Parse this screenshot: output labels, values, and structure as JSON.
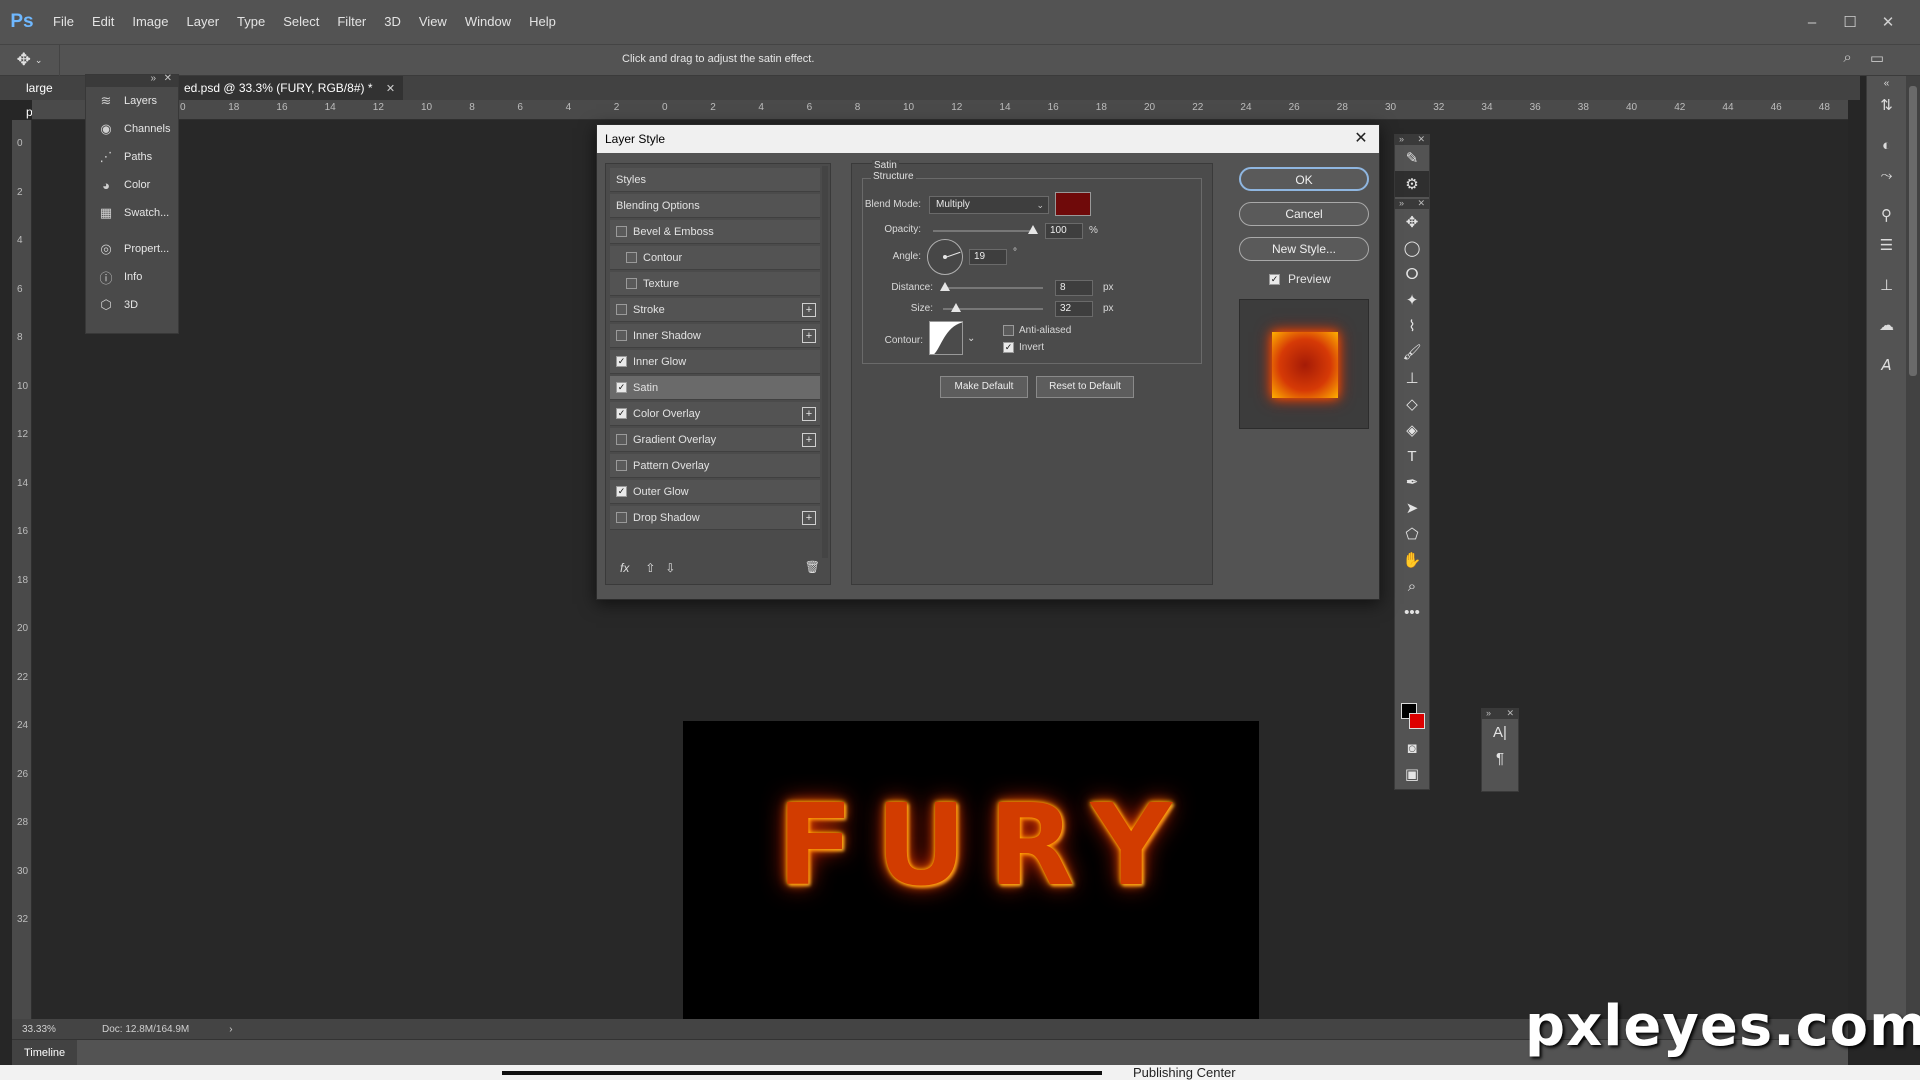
{
  "app": {
    "logo": "Ps"
  },
  "menu": [
    "File",
    "Edit",
    "Image",
    "Layer",
    "Type",
    "Select",
    "Filter",
    "3D",
    "View",
    "Window",
    "Help"
  ],
  "window_controls": {
    "minimize": "–",
    "maximize": "☐",
    "close": "✕"
  },
  "options_bar": {
    "hint": "Click and drag to adjust the satin effect."
  },
  "tabs": [
    {
      "label": "large poste",
      "active": false
    },
    {
      "label": "ed.psd @ 33.3% (FURY, RGB/8#) *",
      "active": true
    }
  ],
  "ruler": {
    "top": [
      "0",
      "18",
      "16",
      "14",
      "12",
      "10",
      "8",
      "6",
      "4",
      "2",
      "0",
      "2",
      "4",
      "6",
      "8",
      "10",
      "12",
      "14",
      "16",
      "18",
      "20",
      "22",
      "24",
      "26",
      "28",
      "30",
      "32",
      "34",
      "36",
      "38",
      "40",
      "42",
      "44",
      "46",
      "48"
    ],
    "left": [
      "0",
      "2",
      "4",
      "6",
      "8",
      "10",
      "12",
      "14",
      "16",
      "18",
      "20",
      "22",
      "24",
      "26",
      "28",
      "30",
      "32"
    ]
  },
  "panels": {
    "items": [
      {
        "label": "Layers",
        "icon": "layers-icon"
      },
      {
        "label": "Channels",
        "icon": "channels-icon"
      },
      {
        "label": "Paths",
        "icon": "paths-icon"
      },
      {
        "label": "Color",
        "icon": "color-icon"
      },
      {
        "label": "Swatch...",
        "icon": "swatches-icon"
      }
    ],
    "items2": [
      {
        "label": "Propert...",
        "icon": "properties-icon"
      },
      {
        "label": "Info",
        "icon": "info-icon"
      },
      {
        "label": "3D",
        "icon": "3d-icon"
      }
    ]
  },
  "document": {
    "text": "FURY"
  },
  "status": {
    "zoom": "33.33%",
    "doc": "Doc: 12.8M/164.9M",
    "arrow": "›"
  },
  "timeline": {
    "label": "Timeline"
  },
  "bottom": {
    "text": "Publishing Center"
  },
  "watermark": "pxleyes.com",
  "dialog": {
    "title": "Layer Style",
    "styles": [
      {
        "label": "Styles",
        "type": "header"
      },
      {
        "label": "Blending Options",
        "type": "header"
      },
      {
        "label": "Bevel & Emboss",
        "checked": false,
        "plus": false,
        "indent": false
      },
      {
        "label": "Contour",
        "checked": false,
        "plus": false,
        "indent": true
      },
      {
        "label": "Texture",
        "checked": false,
        "plus": false,
        "indent": true
      },
      {
        "label": "Stroke",
        "checked": false,
        "plus": true,
        "indent": false
      },
      {
        "label": "Inner Shadow",
        "checked": false,
        "plus": true,
        "indent": false
      },
      {
        "label": "Inner Glow",
        "checked": true,
        "plus": false,
        "indent": false
      },
      {
        "label": "Satin",
        "checked": true,
        "plus": false,
        "indent": false,
        "selected": true
      },
      {
        "label": "Color Overlay",
        "checked": true,
        "plus": true,
        "indent": false
      },
      {
        "label": "Gradient Overlay",
        "checked": false,
        "plus": true,
        "indent": false
      },
      {
        "label": "Pattern Overlay",
        "checked": false,
        "plus": false,
        "indent": false
      },
      {
        "label": "Outer Glow",
        "checked": true,
        "plus": false,
        "indent": false
      },
      {
        "label": "Drop Shadow",
        "checked": false,
        "plus": true,
        "indent": false
      }
    ],
    "footer": {
      "fx": "fx"
    },
    "satin": {
      "group": "Satin",
      "structure": "Structure",
      "blend_label": "Blend Mode:",
      "blend_mode": "Multiply",
      "color": "#6f0a0a",
      "opacity_label": "Opacity:",
      "opacity": "100",
      "opacity_unit": "%",
      "opacity_fraction": 1.0,
      "angle_label": "Angle:",
      "angle": "19",
      "angle_unit": "°",
      "distance_label": "Distance:",
      "distance": "8",
      "distance_unit": "px",
      "size_label": "Size:",
      "size": "32",
      "size_unit": "px",
      "contour_label": "Contour:",
      "anti_aliased_label": "Anti-aliased",
      "anti_aliased": false,
      "invert_label": "Invert",
      "invert": true,
      "make_default": "Make Default",
      "reset_default": "Reset to Default"
    },
    "buttons": {
      "ok": "OK",
      "cancel": "Cancel",
      "new_style": "New Style..."
    },
    "preview": {
      "label": "Preview",
      "checked": true
    }
  }
}
